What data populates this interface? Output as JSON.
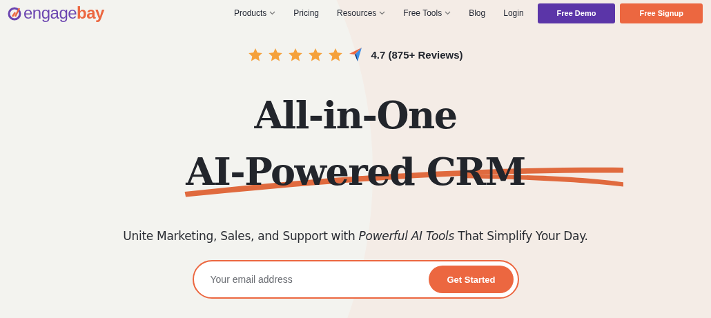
{
  "logo": {
    "prefix": "engage",
    "suffix": "bay"
  },
  "nav": [
    {
      "label": "Products",
      "dropdown": true
    },
    {
      "label": "Pricing",
      "dropdown": false
    },
    {
      "label": "Resources",
      "dropdown": true
    },
    {
      "label": "Free Tools",
      "dropdown": true
    },
    {
      "label": "Blog",
      "dropdown": false
    },
    {
      "label": "Login",
      "dropdown": false
    }
  ],
  "nav_buttons": [
    {
      "label": "Free Demo",
      "kind": "primary"
    },
    {
      "label": "Free Signup",
      "kind": "accent"
    }
  ],
  "rating": {
    "stars": 5,
    "text": "4.7 (875+ Reviews)"
  },
  "headline": [
    "All-in-One",
    "AI-Powered CRM"
  ],
  "subtitle": "Unite Marketing, Sales, and Support with *Powerful AI Tools* That Simplify Your Day.",
  "signup": {
    "placeholder": "Your email address",
    "button": "Get Started"
  }
}
